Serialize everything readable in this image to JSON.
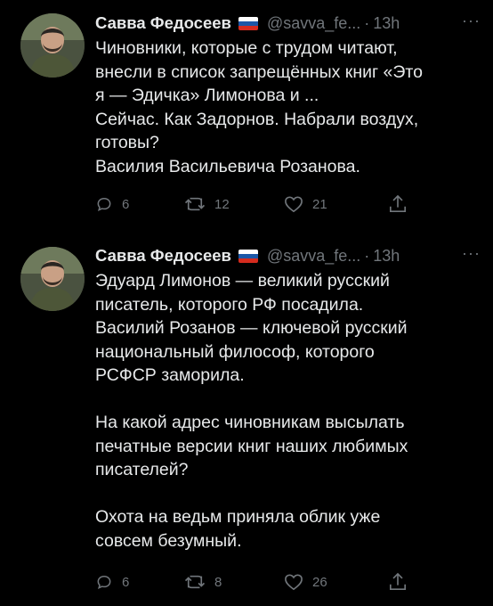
{
  "tweets": [
    {
      "name": "Савва Федосеев",
      "handle": "@savva_fe...",
      "dot": "·",
      "time": "13h",
      "more": "···",
      "lines": [
        "Чиновники, которые с трудом читают,",
        "внесли в список запрещённых книг «Это",
        "я — Эдичка» Лимонова и ...",
        "Сейчас. Как Задорнов. Набрали воздух,",
        "готовы?",
        "Василия Васильевича Розанова."
      ],
      "replies": "6",
      "retweets": "12",
      "likes": "21"
    },
    {
      "name": "Савва Федосеев",
      "handle": "@savva_fe...",
      "dot": "·",
      "time": "13h",
      "more": "···",
      "lines": [
        "Эдуард Лимонов — великий русский",
        "писатель, которого РФ посадила.",
        "Василий Розанов — ключевой русский",
        "национальный философ, которого",
        "РСФСР заморила.",
        "",
        "На какой адрес чиновникам высылать",
        "печатные версии книг наших любимых",
        "писателей?",
        "",
        "Охота на ведьм приняла облик уже",
        "совсем безумный."
      ],
      "replies": "6",
      "retweets": "8",
      "likes": "26"
    }
  ],
  "icons": {
    "reply": "reply-icon",
    "retweet": "retweet-icon",
    "like": "heart-icon",
    "share": "share-icon",
    "flag": "russian-flag-icon"
  },
  "colors": {
    "background": "#000000",
    "text": "#e7e9ea",
    "muted": "#71767b",
    "flag_white": "#ffffff",
    "flag_blue": "#1c57a7",
    "flag_red": "#d52b1e"
  }
}
